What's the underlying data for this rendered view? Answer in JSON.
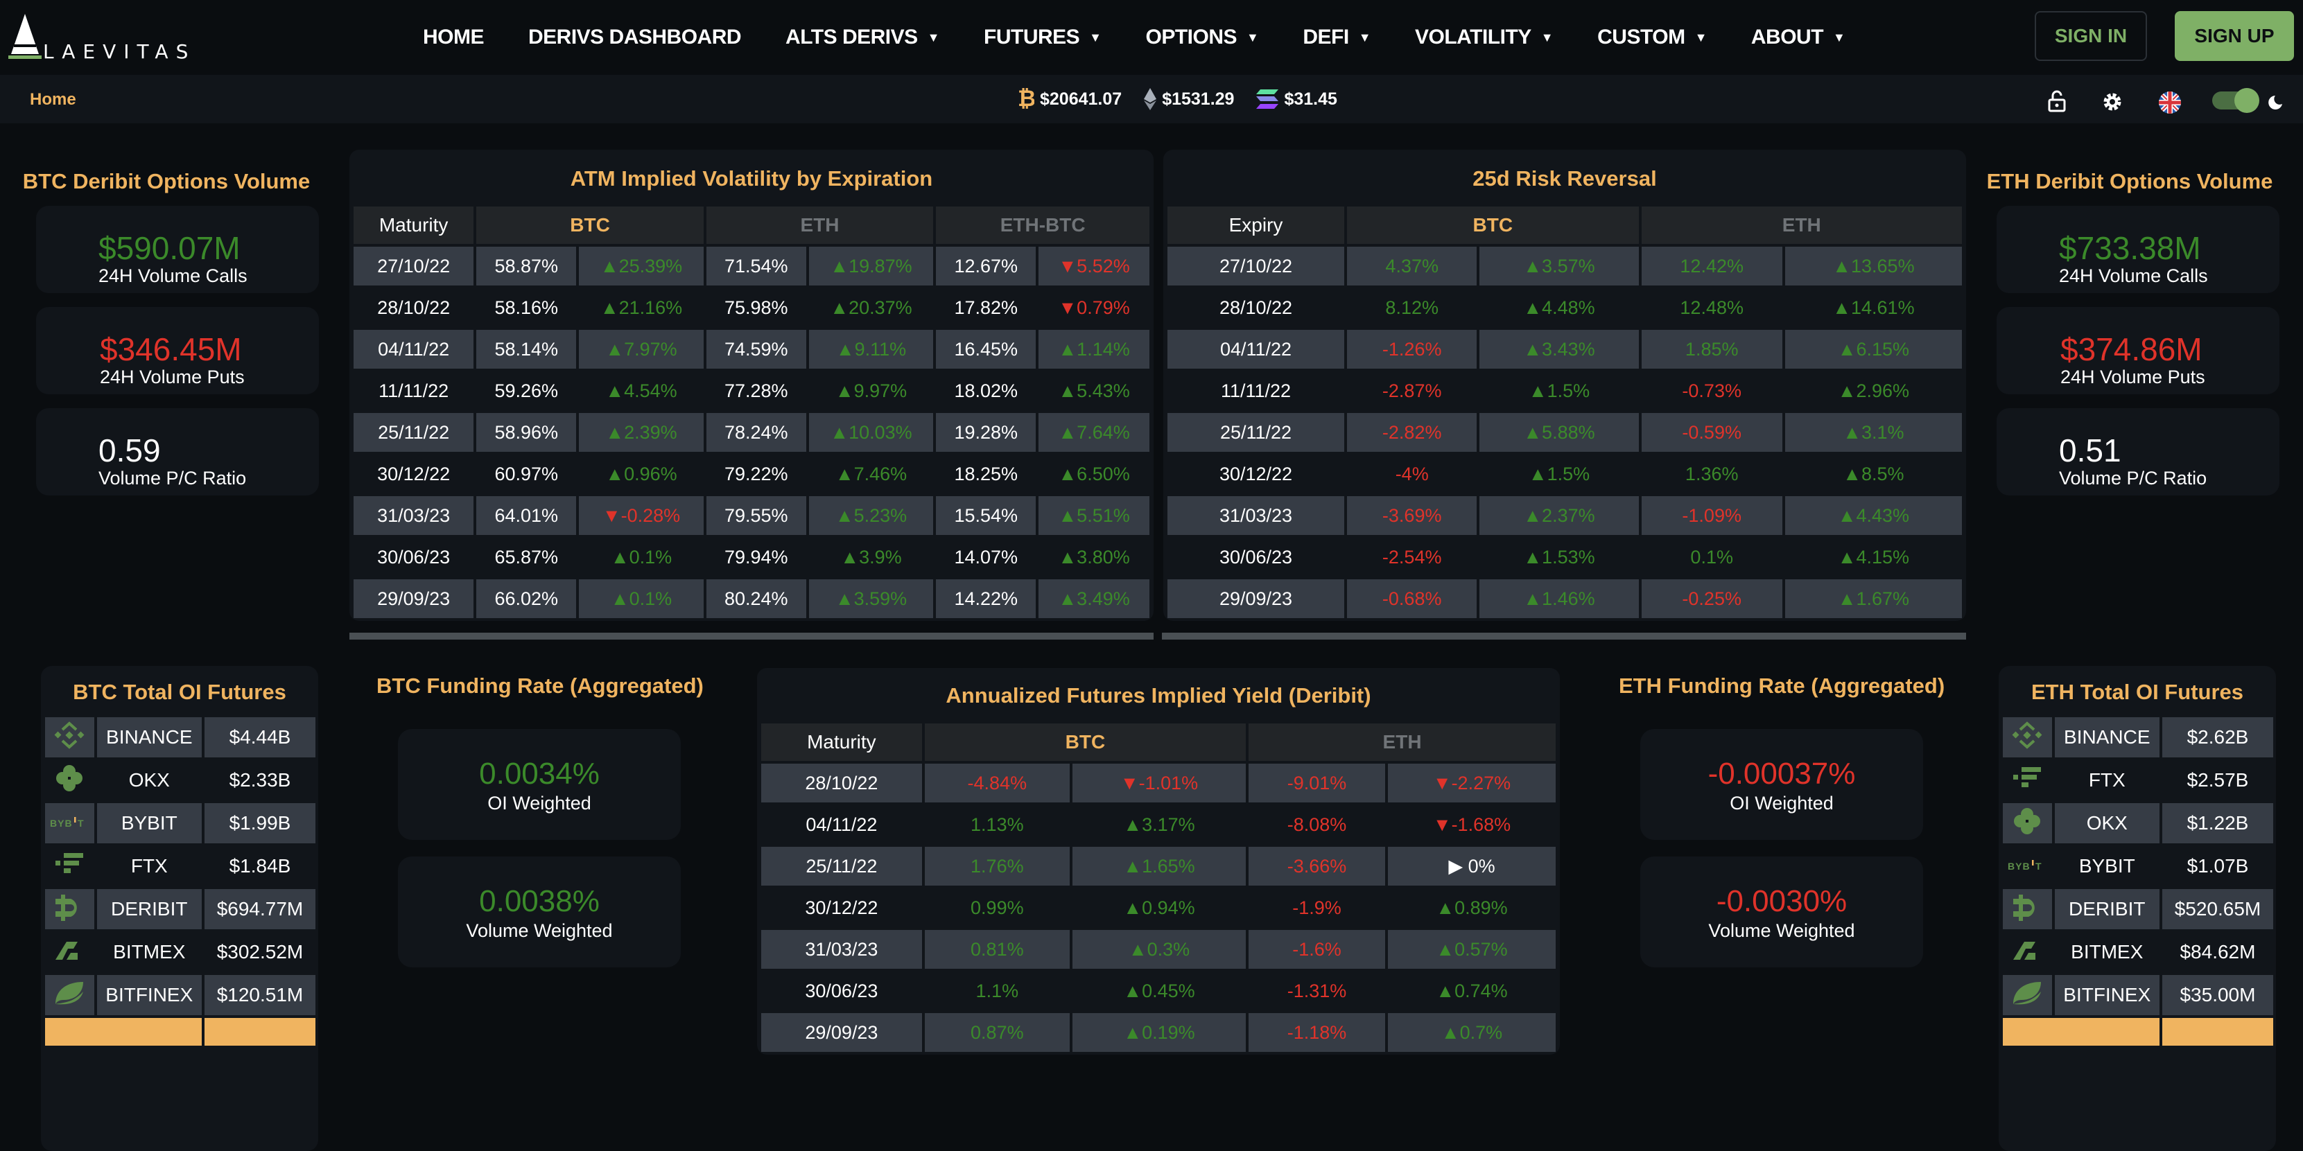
{
  "header": {
    "logo_text": "LAEVITAS",
    "nav": [
      {
        "label": "HOME",
        "dropdown": false
      },
      {
        "label": "DERIVS DASHBOARD",
        "dropdown": false
      },
      {
        "label": "ALTS DERIVS",
        "dropdown": true
      },
      {
        "label": "FUTURES",
        "dropdown": true
      },
      {
        "label": "OPTIONS",
        "dropdown": true
      },
      {
        "label": "DEFI",
        "dropdown": true
      },
      {
        "label": "VOLATILITY",
        "dropdown": true
      },
      {
        "label": "CUSTOM",
        "dropdown": true
      },
      {
        "label": "ABOUT",
        "dropdown": true
      }
    ],
    "sign_in": "SIGN IN",
    "sign_up": "SIGN UP"
  },
  "subbar": {
    "breadcrumb": "Home",
    "tickers": [
      {
        "icon": "bitcoin-icon",
        "price": "$20641.07"
      },
      {
        "icon": "ethereum-icon",
        "price": "$1531.29"
      },
      {
        "icon": "solana-icon",
        "price": "$31.45"
      }
    ],
    "dark_mode": true
  },
  "colors": {
    "accent_gold": "#f0b460",
    "positive": "#3b8a2a",
    "negative": "#e0332a",
    "brand_green": "#7fb066"
  },
  "btc_options_volume": {
    "title": "BTC Deribit Options Volume",
    "calls": {
      "value": "$590.07M",
      "label": "24H Volume Calls"
    },
    "puts": {
      "value": "$346.45M",
      "label": "24H Volume Puts"
    },
    "ratio": {
      "value": "0.59",
      "label": "Volume P/C Ratio"
    }
  },
  "eth_options_volume": {
    "title": "ETH Deribit Options Volume",
    "calls": {
      "value": "$733.38M",
      "label": "24H Volume Calls"
    },
    "puts": {
      "value": "$374.86M",
      "label": "24H Volume Puts"
    },
    "ratio": {
      "value": "0.51",
      "label": "Volume P/C Ratio"
    }
  },
  "atm_iv": {
    "title": "ATM Implied Volatility by Expiration",
    "headers": [
      "Maturity",
      "BTC",
      "ETH",
      "ETH-BTC"
    ],
    "rows": [
      {
        "maturity": "27/10/22",
        "btc": "58.87%",
        "btc_chg": "25.39%",
        "btc_dir": "up",
        "eth": "71.54%",
        "eth_chg": "19.87%",
        "eth_dir": "up",
        "ethbtc": "12.67%",
        "ethbtc_chg": "5.52%",
        "ethbtc_dir": "down"
      },
      {
        "maturity": "28/10/22",
        "btc": "58.16%",
        "btc_chg": "21.16%",
        "btc_dir": "up",
        "eth": "75.98%",
        "eth_chg": "20.37%",
        "eth_dir": "up",
        "ethbtc": "17.82%",
        "ethbtc_chg": "0.79%",
        "ethbtc_dir": "down"
      },
      {
        "maturity": "04/11/22",
        "btc": "58.14%",
        "btc_chg": "7.97%",
        "btc_dir": "up",
        "eth": "74.59%",
        "eth_chg": "9.11%",
        "eth_dir": "up",
        "ethbtc": "16.45%",
        "ethbtc_chg": "1.14%",
        "ethbtc_dir": "up"
      },
      {
        "maturity": "11/11/22",
        "btc": "59.26%",
        "btc_chg": "4.54%",
        "btc_dir": "up",
        "eth": "77.28%",
        "eth_chg": "9.97%",
        "eth_dir": "up",
        "ethbtc": "18.02%",
        "ethbtc_chg": "5.43%",
        "ethbtc_dir": "up"
      },
      {
        "maturity": "25/11/22",
        "btc": "58.96%",
        "btc_chg": "2.39%",
        "btc_dir": "up",
        "eth": "78.24%",
        "eth_chg": "10.03%",
        "eth_dir": "up",
        "ethbtc": "19.28%",
        "ethbtc_chg": "7.64%",
        "ethbtc_dir": "up"
      },
      {
        "maturity": "30/12/22",
        "btc": "60.97%",
        "btc_chg": "0.96%",
        "btc_dir": "up",
        "eth": "79.22%",
        "eth_chg": "7.46%",
        "eth_dir": "up",
        "ethbtc": "18.25%",
        "ethbtc_chg": "6.50%",
        "ethbtc_dir": "up"
      },
      {
        "maturity": "31/03/23",
        "btc": "64.01%",
        "btc_chg": "-0.28%",
        "btc_dir": "down",
        "eth": "79.55%",
        "eth_chg": "5.23%",
        "eth_dir": "up",
        "ethbtc": "15.54%",
        "ethbtc_chg": "5.51%",
        "ethbtc_dir": "up"
      },
      {
        "maturity": "30/06/23",
        "btc": "65.87%",
        "btc_chg": "0.1%",
        "btc_dir": "up",
        "eth": "79.94%",
        "eth_chg": "3.9%",
        "eth_dir": "up",
        "ethbtc": "14.07%",
        "ethbtc_chg": "3.80%",
        "ethbtc_dir": "up"
      },
      {
        "maturity": "29/09/23",
        "btc": "66.02%",
        "btc_chg": "0.1%",
        "btc_dir": "up",
        "eth": "80.24%",
        "eth_chg": "3.59%",
        "eth_dir": "up",
        "ethbtc": "14.22%",
        "ethbtc_chg": "3.49%",
        "ethbtc_dir": "up"
      }
    ]
  },
  "risk_reversal": {
    "title": "25d Risk Reversal",
    "headers": [
      "Expiry",
      "BTC",
      "ETH"
    ],
    "rows": [
      {
        "expiry": "27/10/22",
        "btc": "4.37%",
        "btc_sign": "pos",
        "btc_chg": "3.57%",
        "btc_dir": "up",
        "eth": "12.42%",
        "eth_sign": "pos",
        "eth_chg": "13.65%",
        "eth_dir": "up"
      },
      {
        "expiry": "28/10/22",
        "btc": "8.12%",
        "btc_sign": "pos",
        "btc_chg": "4.48%",
        "btc_dir": "up",
        "eth": "12.48%",
        "eth_sign": "pos",
        "eth_chg": "14.61%",
        "eth_dir": "up"
      },
      {
        "expiry": "04/11/22",
        "btc": "-1.26%",
        "btc_sign": "neg",
        "btc_chg": "3.43%",
        "btc_dir": "up",
        "eth": "1.85%",
        "eth_sign": "pos",
        "eth_chg": "6.15%",
        "eth_dir": "up"
      },
      {
        "expiry": "11/11/22",
        "btc": "-2.87%",
        "btc_sign": "neg",
        "btc_chg": "1.5%",
        "btc_dir": "up",
        "eth": "-0.73%",
        "eth_sign": "neg",
        "eth_chg": "2.96%",
        "eth_dir": "up"
      },
      {
        "expiry": "25/11/22",
        "btc": "-2.82%",
        "btc_sign": "neg",
        "btc_chg": "5.88%",
        "btc_dir": "up",
        "eth": "-0.59%",
        "eth_sign": "neg",
        "eth_chg": "3.1%",
        "eth_dir": "up"
      },
      {
        "expiry": "30/12/22",
        "btc": "-4%",
        "btc_sign": "neg",
        "btc_chg": "1.5%",
        "btc_dir": "up",
        "eth": "1.36%",
        "eth_sign": "pos",
        "eth_chg": "8.5%",
        "eth_dir": "up"
      },
      {
        "expiry": "31/03/23",
        "btc": "-3.69%",
        "btc_sign": "neg",
        "btc_chg": "2.37%",
        "btc_dir": "up",
        "eth": "-1.09%",
        "eth_sign": "neg",
        "eth_chg": "4.43%",
        "eth_dir": "up"
      },
      {
        "expiry": "30/06/23",
        "btc": "-2.54%",
        "btc_sign": "neg",
        "btc_chg": "1.53%",
        "btc_dir": "up",
        "eth": "0.1%",
        "eth_sign": "pos",
        "eth_chg": "4.15%",
        "eth_dir": "up"
      },
      {
        "expiry": "29/09/23",
        "btc": "-0.68%",
        "btc_sign": "neg",
        "btc_chg": "1.46%",
        "btc_dir": "up",
        "eth": "-0.25%",
        "eth_sign": "neg",
        "eth_chg": "1.67%",
        "eth_dir": "up"
      }
    ]
  },
  "btc_funding": {
    "title": "BTC Funding Rate (Aggregated)",
    "oi_weighted": {
      "value": "0.0034%",
      "label": "OI Weighted"
    },
    "volume_weighted": {
      "value": "0.0038%",
      "label": "Volume Weighted"
    }
  },
  "eth_funding": {
    "title": "ETH Funding Rate (Aggregated)",
    "oi_weighted": {
      "value": "-0.00037%",
      "label": "OI Weighted"
    },
    "volume_weighted": {
      "value": "-0.0030%",
      "label": "Volume Weighted"
    }
  },
  "futures_yield": {
    "title": "Annualized Futures Implied Yield (Deribit)",
    "headers": [
      "Maturity",
      "BTC",
      "ETH"
    ],
    "rows": [
      {
        "maturity": "28/10/22",
        "btc": "-4.84%",
        "btc_sign": "neg",
        "btc_chg": "-1.01%",
        "btc_dir": "down",
        "eth": "-9.01%",
        "eth_sign": "neg",
        "eth_chg": "-2.27%",
        "eth_dir": "down"
      },
      {
        "maturity": "04/11/22",
        "btc": "1.13%",
        "btc_sign": "pos",
        "btc_chg": "3.17%",
        "btc_dir": "up",
        "eth": "-8.08%",
        "eth_sign": "neg",
        "eth_chg": "-1.68%",
        "eth_dir": "down"
      },
      {
        "maturity": "25/11/22",
        "btc": "1.76%",
        "btc_sign": "pos",
        "btc_chg": "1.65%",
        "btc_dir": "up",
        "eth": "-3.66%",
        "eth_sign": "neg",
        "eth_chg": "0%",
        "eth_dir": "flat"
      },
      {
        "maturity": "30/12/22",
        "btc": "0.99%",
        "btc_sign": "pos",
        "btc_chg": "0.94%",
        "btc_dir": "up",
        "eth": "-1.9%",
        "eth_sign": "neg",
        "eth_chg": "0.89%",
        "eth_dir": "up"
      },
      {
        "maturity": "31/03/23",
        "btc": "0.81%",
        "btc_sign": "pos",
        "btc_chg": "0.3%",
        "btc_dir": "up",
        "eth": "-1.6%",
        "eth_sign": "neg",
        "eth_chg": "0.57%",
        "eth_dir": "up"
      },
      {
        "maturity": "30/06/23",
        "btc": "1.1%",
        "btc_sign": "pos",
        "btc_chg": "0.45%",
        "btc_dir": "up",
        "eth": "-1.31%",
        "eth_sign": "neg",
        "eth_chg": "0.74%",
        "eth_dir": "up"
      },
      {
        "maturity": "29/09/23",
        "btc": "0.87%",
        "btc_sign": "pos",
        "btc_chg": "0.19%",
        "btc_dir": "up",
        "eth": "-1.18%",
        "eth_sign": "neg",
        "eth_chg": "0.7%",
        "eth_dir": "up"
      }
    ]
  },
  "btc_oi": {
    "title": "BTC Total OI Futures",
    "rows": [
      {
        "exchange": "BINANCE",
        "icon": "binance-icon",
        "value": "$4.44B"
      },
      {
        "exchange": "OKX",
        "icon": "okx-icon",
        "value": "$2.33B"
      },
      {
        "exchange": "BYBIT",
        "icon": "bybit-icon",
        "value": "$1.99B"
      },
      {
        "exchange": "FTX",
        "icon": "ftx-icon",
        "value": "$1.84B"
      },
      {
        "exchange": "DERIBIT",
        "icon": "deribit-icon",
        "value": "$694.77M"
      },
      {
        "exchange": "BITMEX",
        "icon": "bitmex-icon",
        "value": "$302.52M"
      },
      {
        "exchange": "BITFINEX",
        "icon": "bitfinex-icon",
        "value": "$120.51M"
      }
    ]
  },
  "eth_oi": {
    "title": "ETH Total OI Futures",
    "rows": [
      {
        "exchange": "BINANCE",
        "icon": "binance-icon",
        "value": "$2.62B"
      },
      {
        "exchange": "FTX",
        "icon": "ftx-icon",
        "value": "$2.57B"
      },
      {
        "exchange": "OKX",
        "icon": "okx-icon",
        "value": "$1.22B"
      },
      {
        "exchange": "BYBIT",
        "icon": "bybit-icon",
        "value": "$1.07B"
      },
      {
        "exchange": "DERIBIT",
        "icon": "deribit-icon",
        "value": "$520.65M"
      },
      {
        "exchange": "BITMEX",
        "icon": "bitmex-icon",
        "value": "$84.62M"
      },
      {
        "exchange": "BITFINEX",
        "icon": "bitfinex-icon",
        "value": "$35.00M"
      }
    ]
  }
}
